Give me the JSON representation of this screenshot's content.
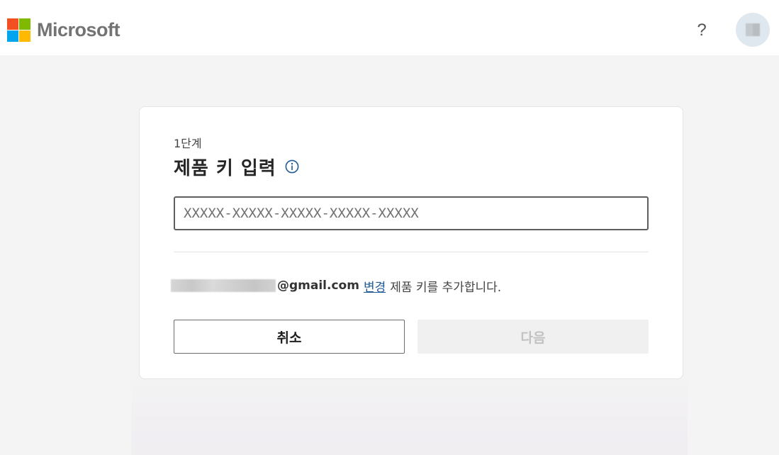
{
  "header": {
    "brand": "Microsoft",
    "help_label": "?",
    "logo_colors": [
      "#f25022",
      "#7fba00",
      "#00a4ef",
      "#ffb900"
    ]
  },
  "card": {
    "step": "1단계",
    "title": "제품 키 입력",
    "info_icon": "info-icon",
    "key_input": {
      "value": "",
      "placeholder": "XXXXX-XXXXX-XXXXX-XXXXX-XXXXX"
    },
    "account": {
      "email_domain": "@gmail.com",
      "change_label": "변경",
      "suffix_text": "제품 키를 추가합니다."
    },
    "buttons": {
      "cancel_label": "취소",
      "next_label": "다음",
      "next_enabled": false
    }
  },
  "colors": {
    "link": "#1e5a96",
    "info_icon": "#1e5a96",
    "disabled_text": "#c2c2c2"
  }
}
